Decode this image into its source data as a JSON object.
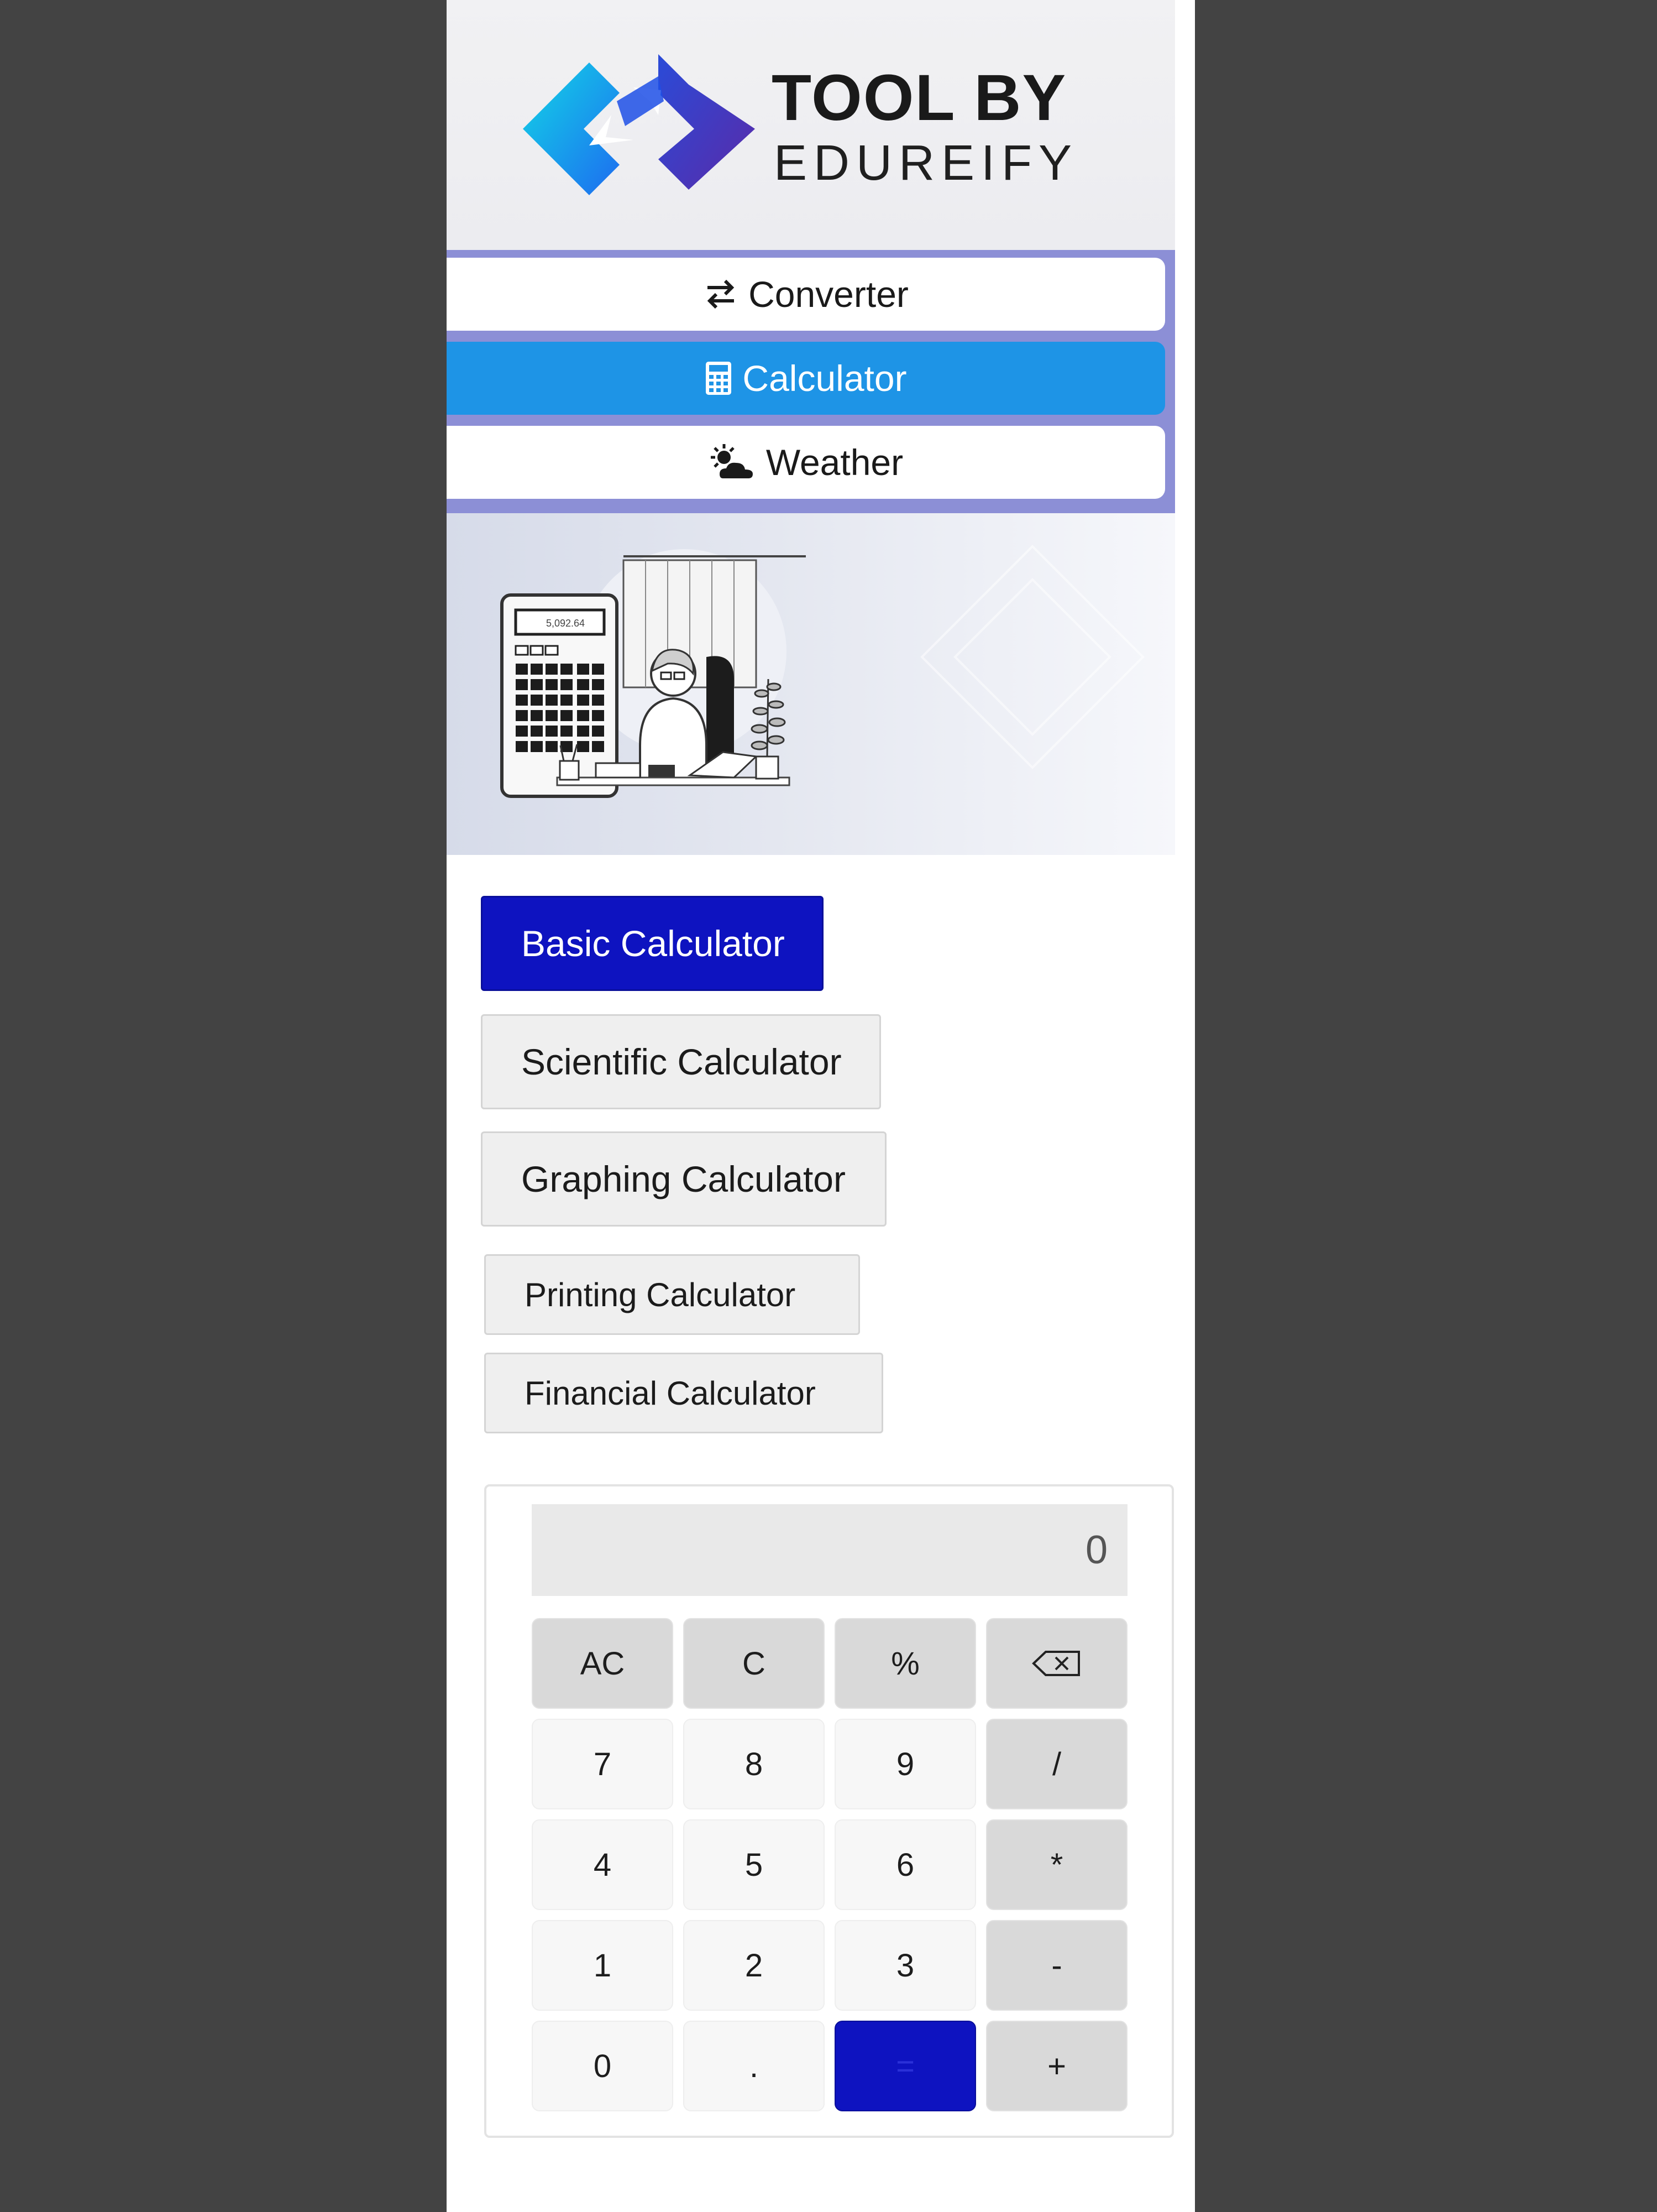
{
  "brand": {
    "line1": "TOOL BY",
    "line2": "EDUREIFY"
  },
  "nav": {
    "tabs": [
      {
        "label": "Converter",
        "icon": "arrows-exchange-icon",
        "active": false
      },
      {
        "label": "Calculator",
        "icon": "calculator-icon",
        "active": true
      },
      {
        "label": "Weather",
        "icon": "sun-cloud-icon",
        "active": false
      }
    ]
  },
  "hero": {
    "illustration": "person-at-desk-with-calculator",
    "calculator_screen": "5,092.64"
  },
  "modes": [
    {
      "label": "Basic Calculator",
      "active": true
    },
    {
      "label": "Scientific Calculator",
      "active": false
    },
    {
      "label": "Graphing Calculator",
      "active": false
    },
    {
      "label": "Printing Calculator",
      "active": false
    },
    {
      "label": "Financial Calculator",
      "active": false
    }
  ],
  "calculator": {
    "display": "0",
    "keys": [
      [
        "AC",
        "C",
        "%",
        "backspace-icon"
      ],
      [
        "7",
        "8",
        "9",
        "/"
      ],
      [
        "4",
        "5",
        "6",
        "*"
      ],
      [
        "1",
        "2",
        "3",
        "-"
      ],
      [
        "0",
        ".",
        "=",
        "+"
      ]
    ]
  },
  "colors": {
    "page_bg": "#434343",
    "nav_active": "#1e94e6",
    "nav_bg": "#8c8fd6",
    "primary": "#0e13c0",
    "key_fn": "#d9d9d9",
    "key_num": "#f7f7f7"
  }
}
